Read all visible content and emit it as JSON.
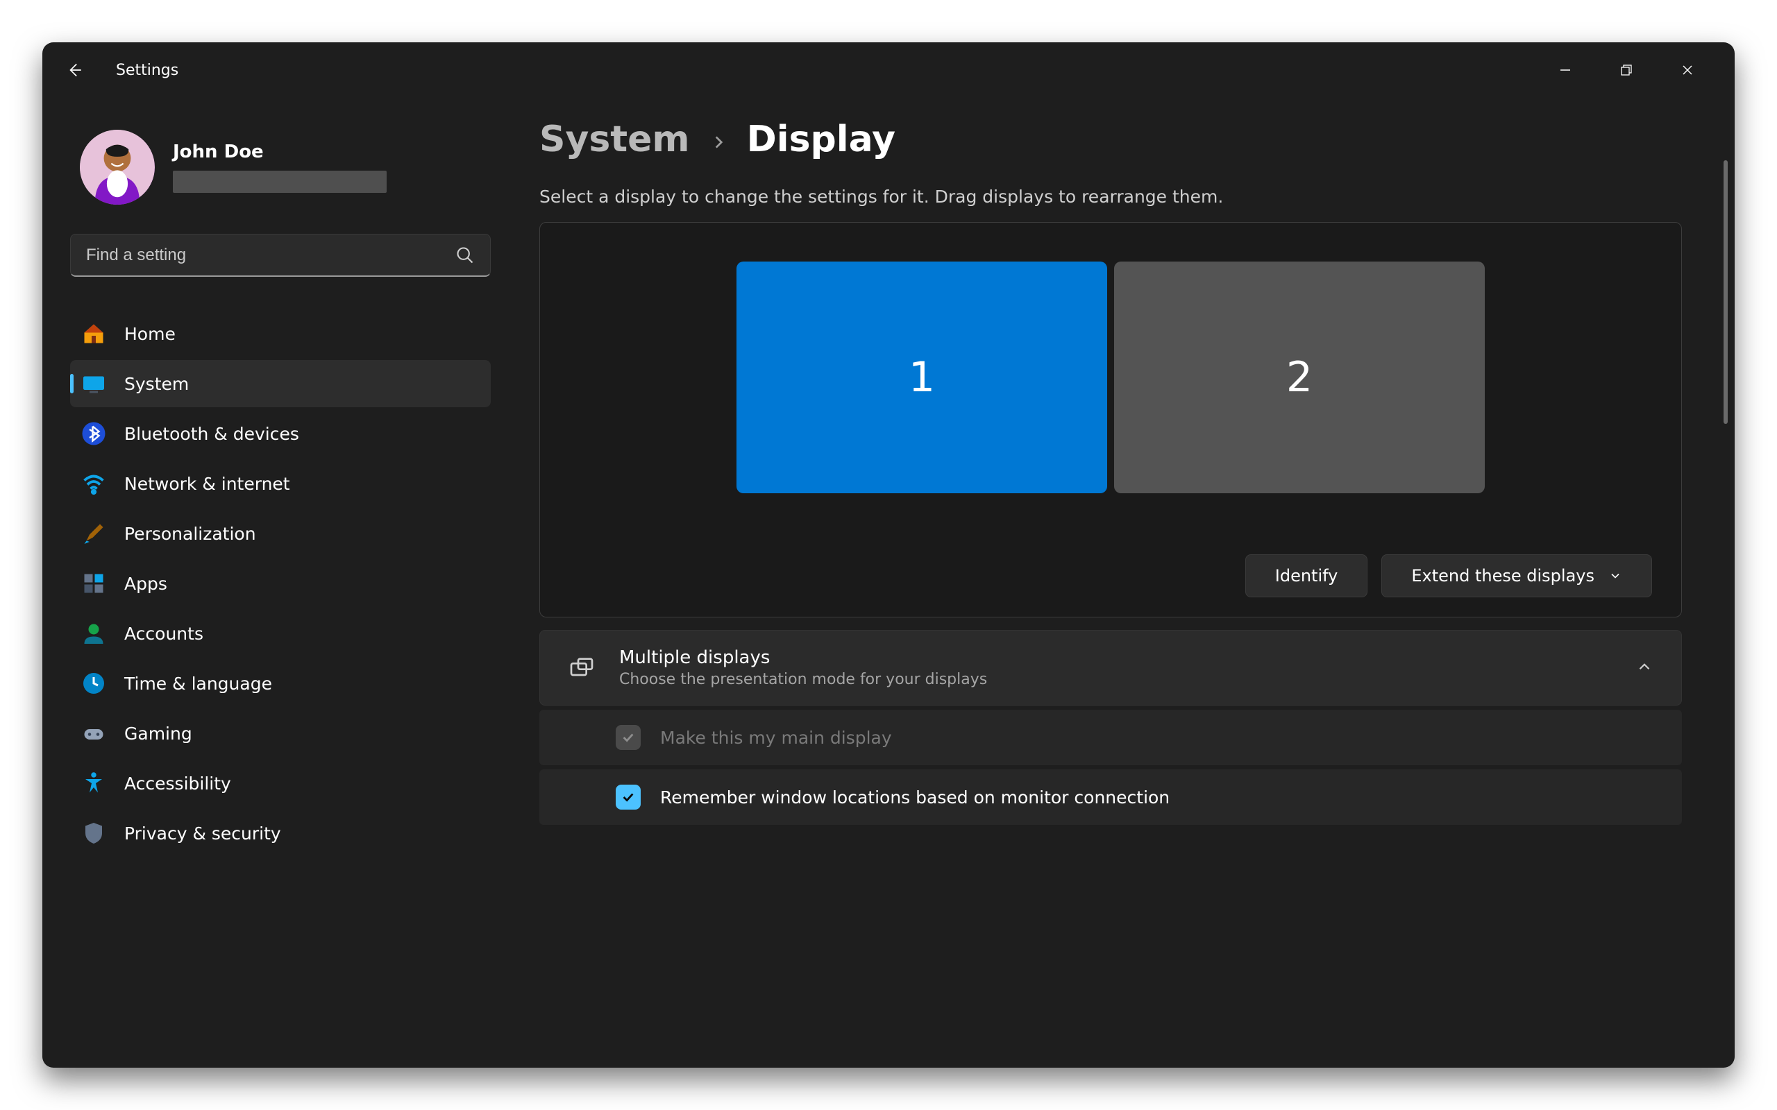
{
  "app_title": "Settings",
  "user": {
    "name": "John Doe"
  },
  "search": {
    "placeholder": "Find a setting"
  },
  "sidebar": {
    "items": [
      {
        "label": "Home"
      },
      {
        "label": "System"
      },
      {
        "label": "Bluetooth & devices"
      },
      {
        "label": "Network & internet"
      },
      {
        "label": "Personalization"
      },
      {
        "label": "Apps"
      },
      {
        "label": "Accounts"
      },
      {
        "label": "Time & language"
      },
      {
        "label": "Gaming"
      },
      {
        "label": "Accessibility"
      },
      {
        "label": "Privacy & security"
      }
    ]
  },
  "breadcrumb": {
    "parent": "System",
    "current": "Display"
  },
  "instruction": "Select a display to change the settings for it. Drag displays to rearrange them.",
  "monitors": {
    "one": "1",
    "two": "2"
  },
  "buttons": {
    "identify": "Identify",
    "extend": "Extend these displays"
  },
  "multiple_displays": {
    "title": "Multiple displays",
    "subtitle": "Choose the presentation mode for your displays"
  },
  "options": {
    "main_display": "Make this my main display",
    "remember_locations": "Remember window locations based on monitor connection"
  }
}
